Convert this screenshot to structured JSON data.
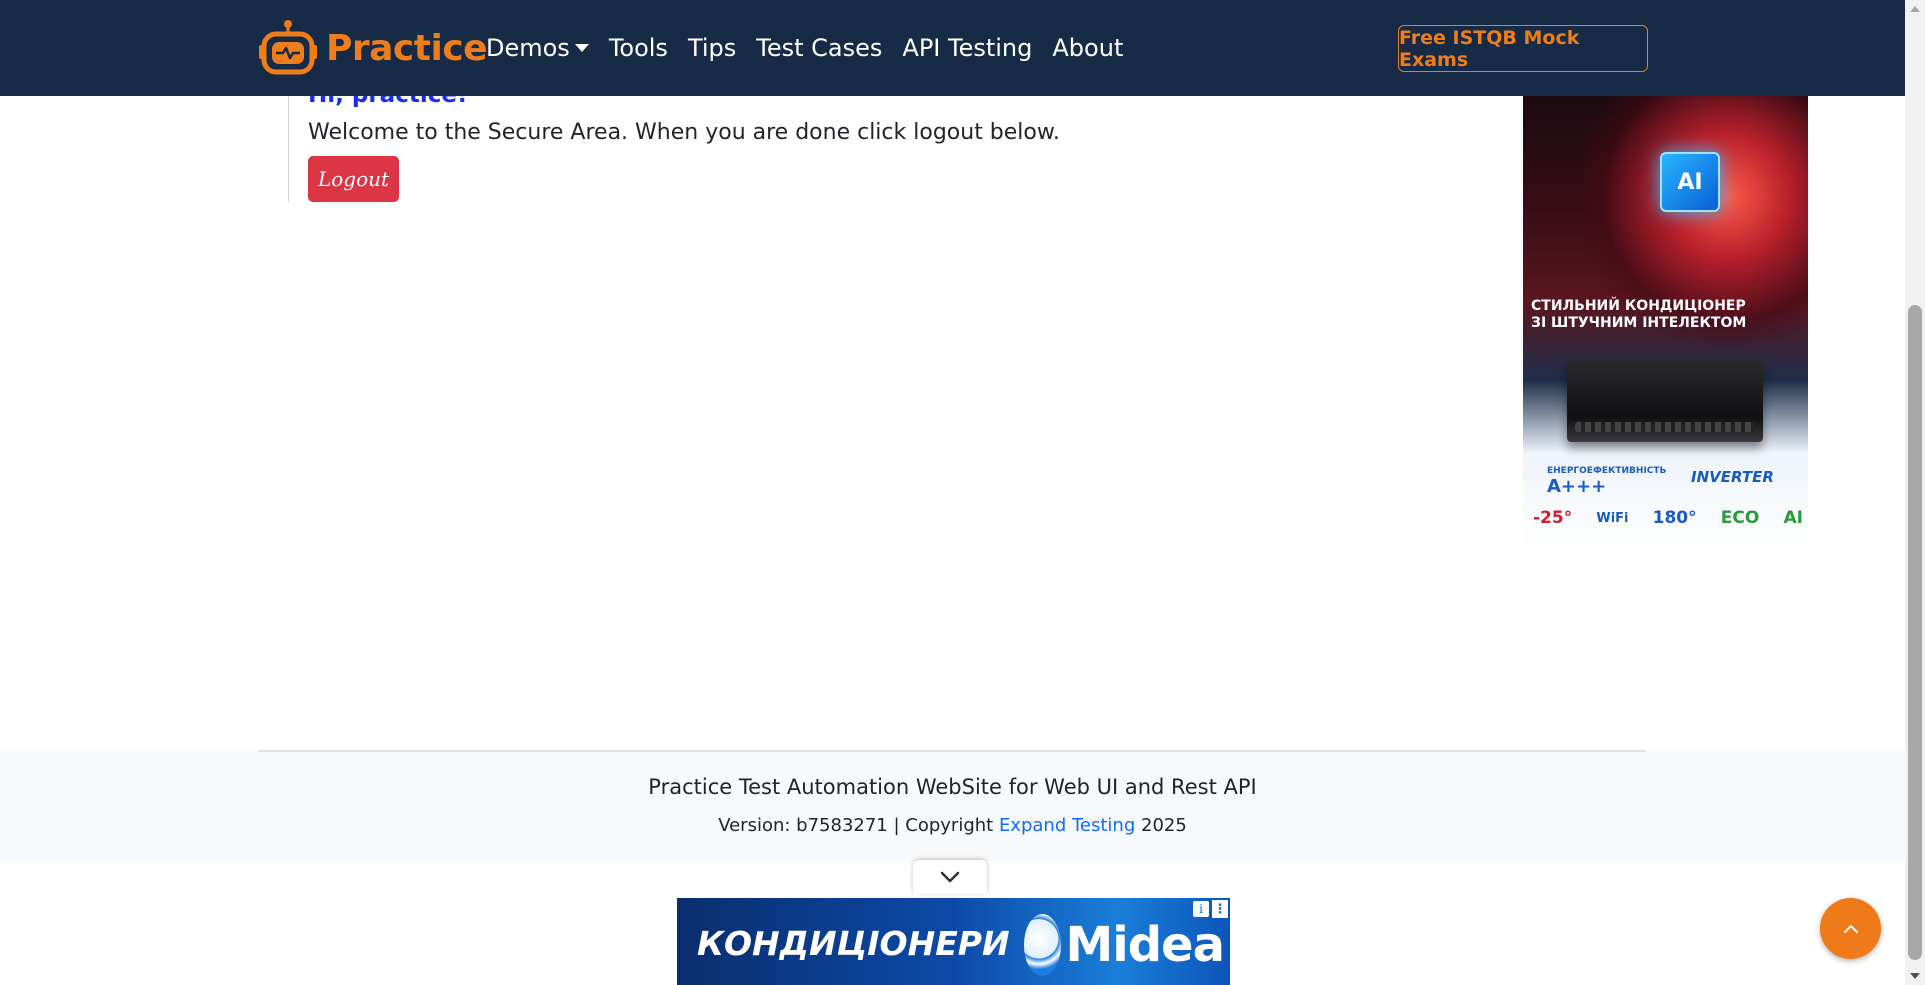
{
  "navbar": {
    "brand": "Practice",
    "links": [
      "Demos",
      "Tools",
      "Tips",
      "Test Cases",
      "API Testing",
      "About"
    ],
    "cta_label": "Free ISTQB Mock Exams"
  },
  "secure_area": {
    "greeting": "Hi, practice!",
    "message": "Welcome to the Secure Area. When you are done click logout below.",
    "logout_label": "Logout"
  },
  "side_ad": {
    "chip_text": "AI",
    "headline_line1": "СТИЛЬНИЙ КОНДИЦІОНЕР",
    "headline_line2": "ЗІ ШТУЧНИМ ІНТЕЛЕКТОМ",
    "efficiency_label": "ЕНЕРГОЕФЕКТИВНІСТЬ",
    "efficiency_class": "A+++",
    "inverter": "INVERTER",
    "features": [
      "-25°",
      "WiFi",
      "180°",
      "ECO",
      "AI"
    ],
    "features_colors": [
      "#d0202a",
      "#1a5bbf",
      "#1a5bbf",
      "#2a9a3a",
      "#2a9a3a"
    ]
  },
  "footer": {
    "title": "Practice Test Automation WebSite for Web UI and Rest API",
    "version_prefix": "Version: b7583271 | Copyright ",
    "link_text": "Expand Testing",
    "year": " 2025"
  },
  "bottom_ad": {
    "text": "КОНДИЦІОНЕРИ",
    "brand": "Midea",
    "info_icon": "i",
    "menu_icon": "⋮"
  },
  "colors": {
    "navbar_bg": "#172a46",
    "brand_orange": "#ee7d1b",
    "logout_red": "#dc3545",
    "greeting_blue": "#1a2eea",
    "link_blue": "#0d6efd"
  }
}
